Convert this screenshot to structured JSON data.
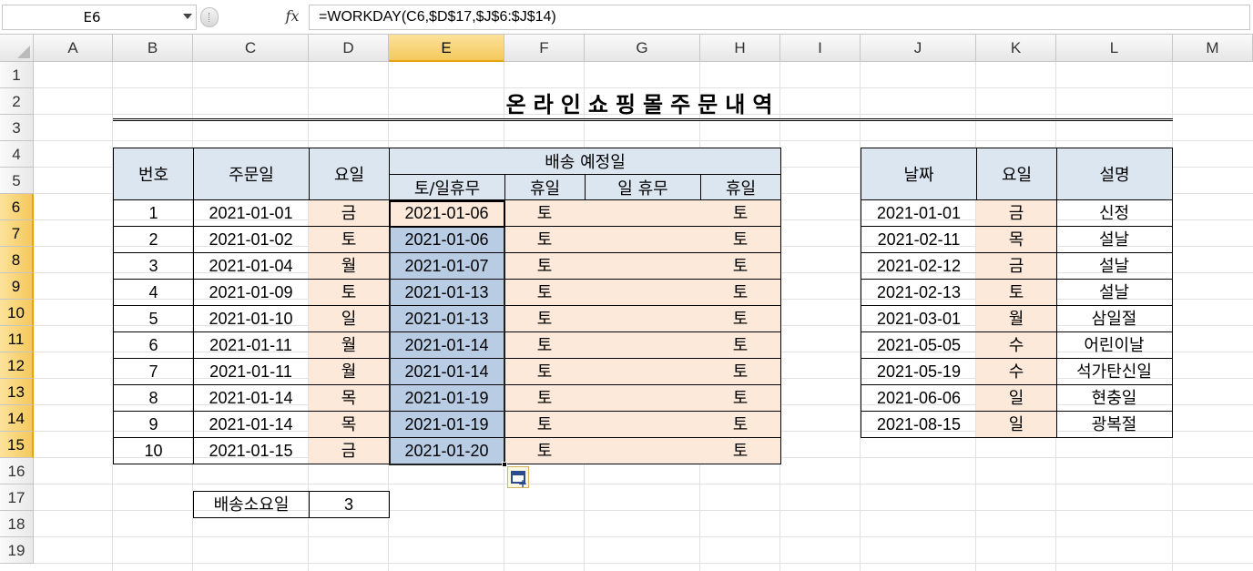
{
  "formula_bar": {
    "name_box": "E6",
    "fx_label": "fx",
    "formula": "=WORKDAY(C6,$D$17,$J$6:$J$14)"
  },
  "columns": [
    "A",
    "B",
    "C",
    "D",
    "E",
    "F",
    "G",
    "H",
    "I",
    "J",
    "K",
    "L",
    "M"
  ],
  "rows": [
    "1",
    "2",
    "3",
    "4",
    "5",
    "6",
    "7",
    "8",
    "9",
    "10",
    "11",
    "12",
    "13",
    "14",
    "15",
    "16",
    "17",
    "18",
    "19"
  ],
  "selected_column": "E",
  "title": "온라인쇼핑몰주문내역",
  "orders": {
    "headers": {
      "no": "번호",
      "order_date": "주문일",
      "weekday": "요일",
      "delivery_group": "배송 예정일",
      "sat_sun_holiday": "토/일휴무",
      "holiday1": "휴일",
      "sun_holiday": "일 휴무",
      "holiday2": "휴일"
    },
    "rows": [
      {
        "no": "1",
        "date": "2021-01-01",
        "wd": "금",
        "e": "2021-01-06",
        "f": "토",
        "g": "",
        "h": "토"
      },
      {
        "no": "2",
        "date": "2021-01-02",
        "wd": "토",
        "e": "2021-01-06",
        "f": "토",
        "g": "",
        "h": "토"
      },
      {
        "no": "3",
        "date": "2021-01-04",
        "wd": "월",
        "e": "2021-01-07",
        "f": "토",
        "g": "",
        "h": "토"
      },
      {
        "no": "4",
        "date": "2021-01-09",
        "wd": "토",
        "e": "2021-01-13",
        "f": "토",
        "g": "",
        "h": "토"
      },
      {
        "no": "5",
        "date": "2021-01-10",
        "wd": "일",
        "e": "2021-01-13",
        "f": "토",
        "g": "",
        "h": "토"
      },
      {
        "no": "6",
        "date": "2021-01-11",
        "wd": "월",
        "e": "2021-01-14",
        "f": "토",
        "g": "",
        "h": "토"
      },
      {
        "no": "7",
        "date": "2021-01-11",
        "wd": "월",
        "e": "2021-01-14",
        "f": "토",
        "g": "",
        "h": "토"
      },
      {
        "no": "8",
        "date": "2021-01-14",
        "wd": "목",
        "e": "2021-01-19",
        "f": "토",
        "g": "",
        "h": "토"
      },
      {
        "no": "9",
        "date": "2021-01-14",
        "wd": "목",
        "e": "2021-01-19",
        "f": "토",
        "g": "",
        "h": "토"
      },
      {
        "no": "10",
        "date": "2021-01-15",
        "wd": "금",
        "e": "2021-01-20",
        "f": "토",
        "g": "",
        "h": "토"
      }
    ]
  },
  "delivery_days": {
    "label": "배송소요일",
    "value": "3"
  },
  "holidays": {
    "headers": {
      "date": "날짜",
      "weekday": "요일",
      "desc": "설명"
    },
    "rows": [
      {
        "date": "2021-01-01",
        "wd": "금",
        "desc": "신정"
      },
      {
        "date": "2021-02-11",
        "wd": "목",
        "desc": "설날"
      },
      {
        "date": "2021-02-12",
        "wd": "금",
        "desc": "설날"
      },
      {
        "date": "2021-02-13",
        "wd": "토",
        "desc": "설날"
      },
      {
        "date": "2021-03-01",
        "wd": "월",
        "desc": "삼일절"
      },
      {
        "date": "2021-05-05",
        "wd": "수",
        "desc": "어린이날"
      },
      {
        "date": "2021-05-19",
        "wd": "수",
        "desc": "석가탄신일"
      },
      {
        "date": "2021-06-06",
        "wd": "일",
        "desc": "현충일"
      },
      {
        "date": "2021-08-15",
        "wd": "일",
        "desc": "광복절"
      }
    ]
  }
}
